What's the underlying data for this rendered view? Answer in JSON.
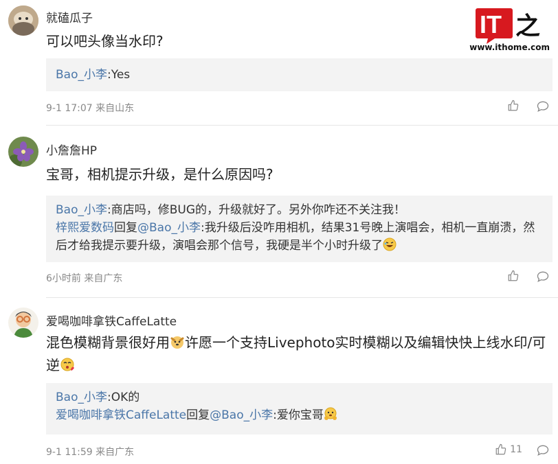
{
  "brand": {
    "logo_text": "IT之家",
    "url": "www.ithome.com"
  },
  "comments": [
    {
      "username": "就磕瓜子",
      "content": "可以吧头像当水印?",
      "replies": [
        {
          "name": "Bao_小李",
          "sep": ":",
          "text": "Yes"
        }
      ],
      "time": "9-1 17:07",
      "location": "来自山东",
      "likes": ""
    },
    {
      "username": "小詹詹HP",
      "content": "宝哥，相机提示升级，是什么原因吗?",
      "replies": [
        {
          "name": "Bao_小李",
          "sep": ":",
          "text": "商店吗，修BUG的，升级就好了。另外你咋还不关注我！"
        },
        {
          "name": "梓熙爱数码",
          "mid": "回复",
          "target": "@Bao_小李",
          "sep": ":",
          "text": "我升级后没咋用相机，结果31号晚上演唱会，相机一直崩溃，然后才给我提示要升级，演唱会那个信号，我硬是半个小时升级了"
        }
      ],
      "time": "6小时前",
      "location": "来自广东",
      "likes": ""
    },
    {
      "username": "爱喝咖啡拿铁CaffeLatte",
      "content_a": "混色模糊背景很好用",
      "content_b": "许愿一个支持Livephoto实时模糊以及编辑快快上线水印/可逆",
      "replies": [
        {
          "name": "Bao_小李",
          "sep": ":",
          "text": "OK的"
        },
        {
          "name": "爱喝咖啡拿铁CaffeLatte",
          "mid": "回复",
          "target": "@Bao_小李",
          "sep": ":",
          "text": "爱你宝哥"
        }
      ],
      "time": "9-1 11:59",
      "location": "来自广东",
      "likes": "11"
    }
  ],
  "icons": {
    "like": "thumbs-up-icon",
    "reply": "speech-bubble-icon"
  },
  "colors": {
    "link": "#4a76a8",
    "meta": "#888888",
    "reply_bg": "#f3f3f3"
  }
}
